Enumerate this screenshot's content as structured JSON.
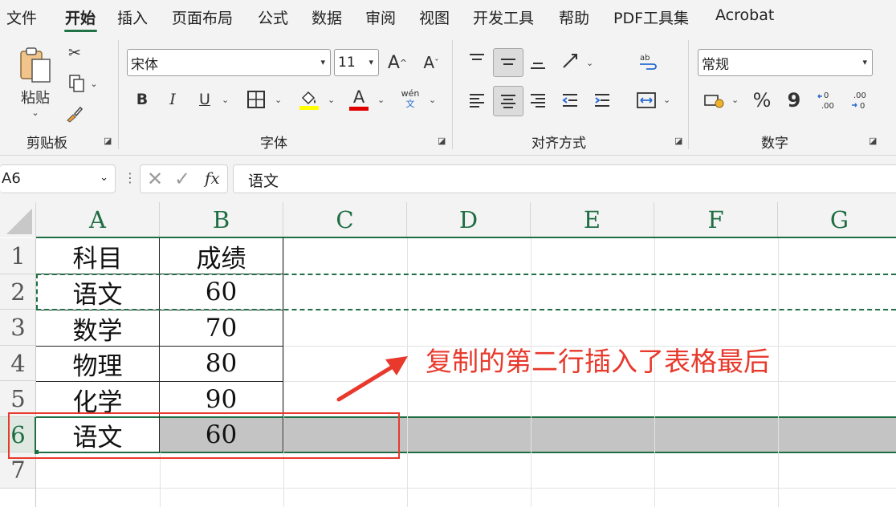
{
  "menu": {
    "items": [
      "文件",
      "开始",
      "插入",
      "页面布局",
      "公式",
      "数据",
      "审阅",
      "视图",
      "开发工具",
      "帮助",
      "PDF工具集",
      "Acrobat"
    ],
    "active_index": 1
  },
  "ribbon": {
    "clipboard": {
      "paste_label": "粘贴",
      "group_label": "剪贴板"
    },
    "font": {
      "font_name": "宋体",
      "font_size": "11",
      "grow_label": "A",
      "shrink_label": "A",
      "bold": "B",
      "italic": "I",
      "underline": "U",
      "fill_label": "A",
      "color_label": "A",
      "phonetic_top": "wén",
      "phonetic_bottom": "文",
      "group_label": "字体",
      "fill_color": "#ffff00",
      "font_color": "#e00000"
    },
    "alignment": {
      "group_label": "对齐方式"
    },
    "number": {
      "format": "常规",
      "percent": "%",
      "comma": "9",
      "group_label": "数字"
    }
  },
  "formula_bar": {
    "name_box": "A6",
    "fx": "fx",
    "content": "语文"
  },
  "sheet": {
    "columns": [
      "A",
      "B",
      "C",
      "D",
      "E",
      "F",
      "G"
    ],
    "rows": [
      "1",
      "2",
      "3",
      "4",
      "5",
      "6",
      "7"
    ],
    "cells": [
      [
        "科目",
        "成绩"
      ],
      [
        "语文",
        "60"
      ],
      [
        "数学",
        "70"
      ],
      [
        "物理",
        "80"
      ],
      [
        "化学",
        "90"
      ],
      [
        "语文",
        "60"
      ],
      [
        "",
        ""
      ]
    ],
    "selected_row": "6",
    "selection_fill": "#c4c4c4"
  },
  "annotation": {
    "text": "复制的第二行插入了表格最后",
    "color": "#e8392c"
  }
}
